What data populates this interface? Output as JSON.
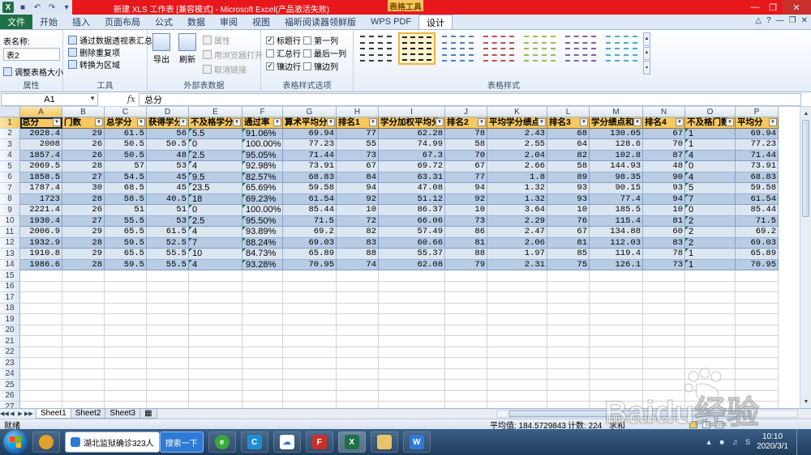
{
  "window": {
    "title": "新建 XLS 工作表 [兼容模式] - Microsoft Excel(产品激活失败)",
    "context_tab": "表格工具"
  },
  "ribbon_tabs": [
    "文件",
    "开始",
    "插入",
    "页面布局",
    "公式",
    "数据",
    "审阅",
    "视图",
    "福昕阅读器领鲜版",
    "WPS PDF",
    "设计"
  ],
  "active_tab": "设计",
  "ribbon": {
    "properties": {
      "table_name_label": "表名称:",
      "table_name_value": "表2",
      "resize_label": "调整表格大小",
      "group_label": "属性"
    },
    "tools": {
      "pivot_label": "通过数据透视表汇总",
      "remove_dup_label": "删除重复项",
      "convert_label": "转换为区域",
      "group_label": "工具"
    },
    "external": {
      "export_label": "导出",
      "refresh_label": "刷新",
      "properties_label": "属性",
      "browser_label": "用浏览器打开",
      "unlink_label": "取消链接",
      "group_label": "外部表数据"
    },
    "style_options": {
      "header_row": "标题行",
      "first_column": "第一列",
      "total_row": "汇总行",
      "last_column": "最后一列",
      "banded_rows": "镶边行",
      "banded_columns": "镶边列",
      "header_row_checked": true,
      "first_column_checked": false,
      "total_row_checked": false,
      "last_column_checked": false,
      "banded_rows_checked": true,
      "banded_columns_checked": false,
      "group_label": "表格样式选项"
    },
    "table_styles": {
      "group_label": "表格样式",
      "swatches": [
        {
          "color": "#3a3a3a",
          "selected": false
        },
        {
          "color": "#1f1f1f",
          "selected": true
        },
        {
          "color": "#4f81bd",
          "selected": false
        },
        {
          "color": "#c0504d",
          "selected": false
        },
        {
          "color": "#9bbb59",
          "selected": false
        },
        {
          "color": "#8064a2",
          "selected": false
        },
        {
          "color": "#4bacc6",
          "selected": false
        }
      ]
    }
  },
  "formula_bar": {
    "name_box": "A1",
    "fx_label": "fx",
    "content": "总分"
  },
  "grid": {
    "columns": [
      "A",
      "B",
      "C",
      "D",
      "E",
      "F",
      "G",
      "H",
      "I",
      "J",
      "K",
      "L",
      "M",
      "N",
      "O",
      "P"
    ],
    "empty_rows": [
      "15",
      "16",
      "17",
      "18",
      "19",
      "20",
      "21",
      "22",
      "23",
      "24",
      "25",
      "26",
      "27",
      "28"
    ],
    "headers": [
      "总分",
      "门数",
      "总学分",
      "获得学分",
      "不及格学分",
      "通过率",
      "算术平均分",
      "排名1",
      "学分加权平均分",
      "排名2",
      "平均学分绩点",
      "排名3",
      "学分绩点和",
      "排名4",
      "不及格门数",
      "平均分"
    ],
    "rows": [
      [
        "2028.4",
        "29",
        "61.5",
        "56",
        "5.5",
        "91.06%",
        "69.94",
        "77",
        "62.28",
        "78",
        "2.43",
        "68",
        "130.05",
        "67",
        "1",
        "69.94"
      ],
      [
        "2008",
        "26",
        "50.5",
        "50.5",
        "0",
        "100.00%",
        "77.23",
        "55",
        "74.99",
        "58",
        "2.55",
        "64",
        "128.6",
        "70",
        "1",
        "77.23"
      ],
      [
        "1857.4",
        "26",
        "50.5",
        "48",
        "2.5",
        "95.05%",
        "71.44",
        "73",
        "67.3",
        "70",
        "2.04",
        "82",
        "102.8",
        "87",
        "4",
        "71.44"
      ],
      [
        "2069.5",
        "28",
        "57",
        "53",
        "4",
        "92.98%",
        "73.91",
        "67",
        "69.72",
        "67",
        "2.66",
        "58",
        "144.93",
        "48",
        "0",
        "73.91"
      ],
      [
        "1858.5",
        "27",
        "54.5",
        "45",
        "9.5",
        "82.57%",
        "68.83",
        "84",
        "63.31",
        "77",
        "1.8",
        "89",
        "98.35",
        "90",
        "4",
        "68.83"
      ],
      [
        "1787.4",
        "30",
        "68.5",
        "45",
        "23.5",
        "65.69%",
        "59.58",
        "94",
        "47.08",
        "94",
        "1.32",
        "93",
        "90.15",
        "93",
        "5",
        "59.58"
      ],
      [
        "1723",
        "28",
        "58.5",
        "40.5",
        "18",
        "69.23%",
        "61.54",
        "92",
        "51.12",
        "92",
        "1.32",
        "93",
        "77.4",
        "94",
        "7",
        "61.54"
      ],
      [
        "2221.4",
        "26",
        "51",
        "51",
        "0",
        "100.00%",
        "85.44",
        "10",
        "86.37",
        "10",
        "3.64",
        "10",
        "185.5",
        "10",
        "0",
        "85.44"
      ],
      [
        "1930.4",
        "27",
        "55.5",
        "53",
        "2.5",
        "95.50%",
        "71.5",
        "72",
        "66.06",
        "73",
        "2.29",
        "76",
        "115.4",
        "81",
        "2",
        "71.5"
      ],
      [
        "2006.9",
        "29",
        "65.5",
        "61.5",
        "4",
        "93.89%",
        "69.2",
        "82",
        "57.49",
        "86",
        "2.47",
        "67",
        "134.88",
        "60",
        "2",
        "69.2"
      ],
      [
        "1932.9",
        "28",
        "59.5",
        "52.5",
        "7",
        "88.24%",
        "69.03",
        "83",
        "60.66",
        "81",
        "2.06",
        "81",
        "112.03",
        "83",
        "2",
        "69.03"
      ],
      [
        "1910.8",
        "29",
        "65.5",
        "55.5",
        "10",
        "84.73%",
        "65.89",
        "88",
        "55.37",
        "88",
        "1.97",
        "85",
        "119.4",
        "78",
        "1",
        "65.89"
      ],
      [
        "1986.6",
        "28",
        "59.5",
        "55.5",
        "4",
        "93.28%",
        "70.95",
        "74",
        "62.08",
        "79",
        "2.31",
        "75",
        "126.1",
        "73",
        "1",
        "70.95"
      ]
    ]
  },
  "sheets": [
    "Sheet1",
    "Sheet2",
    "Sheet3"
  ],
  "active_sheet": "Sheet1",
  "status": {
    "ready": "就绪",
    "average": "平均值: 184.5729843",
    "count": "计数: 224",
    "sum": "求和"
  },
  "taskbar": {
    "news_label": "湖北监狱确诊323人",
    "search_label": "搜索一下",
    "time": "10:10",
    "date": "2020/3/1"
  },
  "watermark": {
    "brand": "Baidu经验",
    "url": "jingyan.baidu.com"
  },
  "colors": {
    "title_bar": "#e8171b",
    "header_fill": "#f6c85f",
    "band_dark": "#b8cce4",
    "band_light": "#dce6f1",
    "excel_green": "#1e7145"
  }
}
